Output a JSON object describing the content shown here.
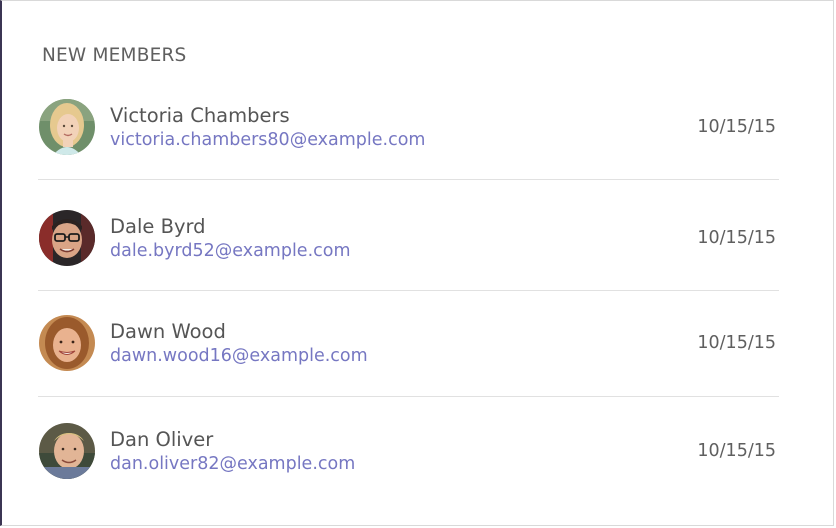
{
  "panel": {
    "title": "NEW MEMBERS"
  },
  "members": [
    {
      "name": "Victoria Chambers",
      "email": "victoria.chambers80@example.com",
      "date": "10/15/15",
      "avatar": "woman-blonde-avatar"
    },
    {
      "name": "Dale Byrd",
      "email": "dale.byrd52@example.com",
      "date": "10/15/15",
      "avatar": "man-glasses-avatar"
    },
    {
      "name": "Dawn Wood",
      "email": "dawn.wood16@example.com",
      "date": "10/15/15",
      "avatar": "woman-brunette-avatar"
    },
    {
      "name": "Dan Oliver",
      "email": "dan.oliver82@example.com",
      "date": "10/15/15",
      "avatar": "man-blond-avatar"
    }
  ],
  "colors": {
    "email_link": "#7677c2",
    "text": "#555555",
    "divider": "#e1e1e1",
    "left_border": "#3b3553"
  }
}
